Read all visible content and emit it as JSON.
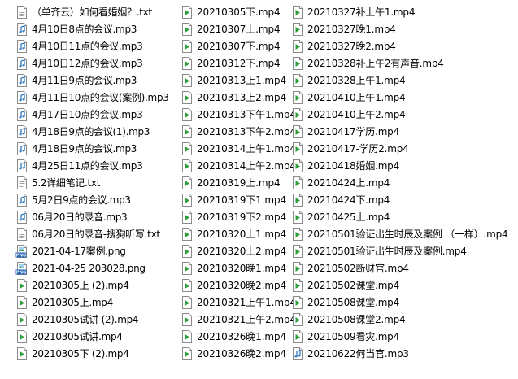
{
  "icons": {
    "mp4": "video-file-icon",
    "mp3": "audio-file-icon",
    "txt": "text-file-icon",
    "png": "image-file-icon"
  },
  "colors": {
    "video_green": "#2e9e3a",
    "audio_blue": "#2f78c4",
    "png_label_blue": "#1f5fb0",
    "page_border": "#9a9a9a"
  },
  "columns": [
    {
      "items": [
        {
          "name": "（单齐云）如何看婚姻？.txt",
          "type": "txt"
        },
        {
          "name": "4月10日8点的会议.mp3",
          "type": "mp3"
        },
        {
          "name": "4月10日11点的会议.mp3",
          "type": "mp3"
        },
        {
          "name": "4月10日12点的会议.mp3",
          "type": "mp3"
        },
        {
          "name": "4月11日9点的会议.mp3",
          "type": "mp3"
        },
        {
          "name": "4月11日10点的会议(案例).mp3",
          "type": "mp3"
        },
        {
          "name": "4月17日10点的会议.mp3",
          "type": "mp3"
        },
        {
          "name": "4月18日9点的会议(1).mp3",
          "type": "mp3"
        },
        {
          "name": "4月18日9点的会议.mp3",
          "type": "mp3"
        },
        {
          "name": "4月25日11点的会议.mp3",
          "type": "mp3"
        },
        {
          "name": "5.2详细笔记.txt",
          "type": "txt"
        },
        {
          "name": "5月2日9点的会议.mp3",
          "type": "mp3"
        },
        {
          "name": "06月20日的录音.mp3",
          "type": "mp3"
        },
        {
          "name": "06月20日的录音-搜狗听写.txt",
          "type": "txt"
        },
        {
          "name": "2021-04-17案例.png",
          "type": "png"
        },
        {
          "name": "2021-04-25 203028.png",
          "type": "png"
        },
        {
          "name": "20210305上 (2).mp4",
          "type": "mp4"
        },
        {
          "name": "20210305上.mp4",
          "type": "mp4"
        },
        {
          "name": "20210305试讲 (2).mp4",
          "type": "mp4"
        },
        {
          "name": "20210305试讲.mp4",
          "type": "mp4"
        },
        {
          "name": "20210305下 (2).mp4",
          "type": "mp4"
        }
      ]
    },
    {
      "items": [
        {
          "name": "20210305下.mp4",
          "type": "mp4"
        },
        {
          "name": "20210307上.mp4",
          "type": "mp4"
        },
        {
          "name": "20210307下.mp4",
          "type": "mp4"
        },
        {
          "name": "20210312下.mp4",
          "type": "mp4"
        },
        {
          "name": "20210313上1.mp4",
          "type": "mp4"
        },
        {
          "name": "20210313上2.mp4",
          "type": "mp4"
        },
        {
          "name": "20210313下午1.mp4",
          "type": "mp4"
        },
        {
          "name": "20210313下午2.mp4",
          "type": "mp4"
        },
        {
          "name": "20210314上午1.mp4",
          "type": "mp4"
        },
        {
          "name": "20210314上午2.mp4",
          "type": "mp4"
        },
        {
          "name": "20210319上.mp4",
          "type": "mp4"
        },
        {
          "name": "20210319下1.mp4",
          "type": "mp4"
        },
        {
          "name": "20210319下2.mp4",
          "type": "mp4"
        },
        {
          "name": "20210320上1.mp4",
          "type": "mp4"
        },
        {
          "name": "20210320上2.mp4",
          "type": "mp4"
        },
        {
          "name": "20210320晚1.mp4",
          "type": "mp4"
        },
        {
          "name": "20210320晚2.mp4",
          "type": "mp4"
        },
        {
          "name": "20210321上午1.mp4",
          "type": "mp4"
        },
        {
          "name": "20210321上午2.mp4",
          "type": "mp4"
        },
        {
          "name": "20210326晚1.mp4",
          "type": "mp4"
        },
        {
          "name": "20210326晚2.mp4",
          "type": "mp4"
        }
      ]
    },
    {
      "items": [
        {
          "name": "20210327补上午1.mp4",
          "type": "mp4"
        },
        {
          "name": "20210327晚1.mp4",
          "type": "mp4"
        },
        {
          "name": "20210327晚2.mp4",
          "type": "mp4"
        },
        {
          "name": "20210328补上午2有声音.mp4",
          "type": "mp4"
        },
        {
          "name": "20210328上午1.mp4",
          "type": "mp4"
        },
        {
          "name": "20210410上午1.mp4",
          "type": "mp4"
        },
        {
          "name": "20210410上午2.mp4",
          "type": "mp4"
        },
        {
          "name": "20210417学历.mp4",
          "type": "mp4"
        },
        {
          "name": "20210417-学历2.mp4",
          "type": "mp4"
        },
        {
          "name": "20210418婚姻.mp4",
          "type": "mp4"
        },
        {
          "name": "20210424上.mp4",
          "type": "mp4"
        },
        {
          "name": "20210424下.mp4",
          "type": "mp4"
        },
        {
          "name": "20210425上.mp4",
          "type": "mp4"
        },
        {
          "name": "20210501验证出生时辰及案例 （一样）.mp4",
          "type": "mp4"
        },
        {
          "name": "20210501验证出生时辰及案例.mp4",
          "type": "mp4"
        },
        {
          "name": "20210502断财官.mp4",
          "type": "mp4"
        },
        {
          "name": "20210502课堂.mp4",
          "type": "mp4"
        },
        {
          "name": "20210508课堂.mp4",
          "type": "mp4"
        },
        {
          "name": "20210508课堂2.mp4",
          "type": "mp4"
        },
        {
          "name": "20210509看灾.mp4",
          "type": "mp4"
        },
        {
          "name": "20210622何当官.mp3",
          "type": "mp3"
        }
      ]
    }
  ]
}
